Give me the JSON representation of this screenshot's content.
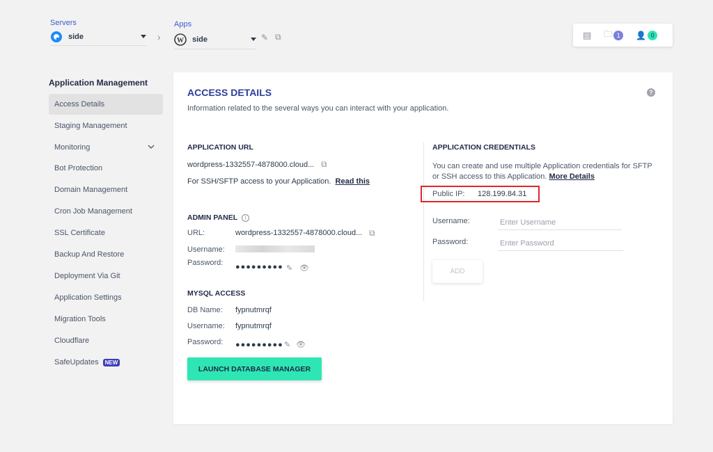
{
  "header": {
    "servers_label": "Servers",
    "server_name": "side",
    "apps_label": "Apps",
    "app_name": "side",
    "widget": {
      "folder_count": "1",
      "users_count": "0"
    }
  },
  "sidebar": {
    "title": "Application Management",
    "items": [
      {
        "label": "Access Details",
        "active": true
      },
      {
        "label": "Staging Management"
      },
      {
        "label": "Monitoring"
      },
      {
        "label": "Bot Protection"
      },
      {
        "label": "Domain Management"
      },
      {
        "label": "Cron Job Management"
      },
      {
        "label": "SSL Certificate"
      },
      {
        "label": "Backup And Restore"
      },
      {
        "label": "Deployment Via Git"
      },
      {
        "label": "Application Settings"
      },
      {
        "label": "Migration Tools"
      },
      {
        "label": "Cloudflare"
      },
      {
        "label": "SafeUpdates",
        "badge": "NEW"
      }
    ]
  },
  "main": {
    "title": "ACCESS DETAILS",
    "subtitle": "Information related to the several ways you can interact with your application.",
    "app_url": {
      "title": "APPLICATION URL",
      "url": "wordpress-1332557-4878000.cloud...",
      "ssh_note": "For SSH/SFTP access to your Application.",
      "read_this": "Read this"
    },
    "admin_panel": {
      "title": "ADMIN PANEL",
      "url_label": "URL:",
      "url": "wordpress-1332557-4878000.cloud...",
      "username_label": "Username:",
      "password_label": "Password:",
      "password": "●●●●●●●●●"
    },
    "mysql": {
      "title": "MYSQL ACCESS",
      "db_label": "DB Name:",
      "db_name": "fypnutmrqf",
      "username_label": "Username:",
      "username": "fypnutmrqf",
      "password_label": "Password:",
      "password": "●●●●●●●●●",
      "launch_button": "LAUNCH DATABASE MANAGER"
    },
    "credentials": {
      "title": "APPLICATION CREDENTIALS",
      "desc_line1": "You can create and use multiple Application credentials for SFTP",
      "desc_line2": "or SSH access to this Application.",
      "more_details": "More Details",
      "public_ip_label": "Public IP:",
      "public_ip": "128.199.84.31",
      "username_label": "Username:",
      "username_placeholder": "Enter Username",
      "password_label": "Password:",
      "password_placeholder": "Enter Password",
      "add_button": "ADD"
    }
  },
  "colors": {
    "accent": "#3d5ccc",
    "title": "#2e3e9b",
    "launch": "#2ee6b4",
    "highlight": "#e0262b",
    "badge_blue": "#7b7fe0",
    "badge_teal": "#2ee6b4"
  }
}
